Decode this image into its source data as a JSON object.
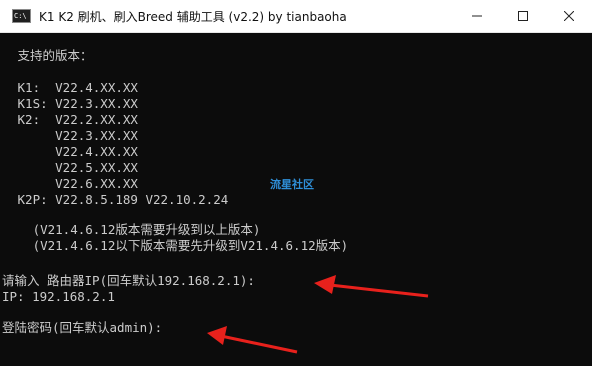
{
  "window": {
    "title": "K1 K2 刷机、刷入Breed 辅助工具 (v2.2)   by tianbaoha",
    "icon_label": "C:\\",
    "controls": [
      "minimize-icon",
      "maximize-icon",
      "close-icon"
    ]
  },
  "console": {
    "lines": [
      " 支持的版本：",
      "",
      " K1:  V22.4.XX.XX",
      " K1S: V22.3.XX.XX",
      " K2:  V22.2.XX.XX",
      "      V22.3.XX.XX",
      "      V22.4.XX.XX",
      "      V22.5.XX.XX",
      "      V22.6.XX.XX",
      " K2P: V22.8.5.189 V22.10.2.24",
      "",
      "   (V21.4.6.12版本需要升级到以上版本)",
      "   (V21.4.6.12以下版本需要先升级到V21.4.6.12版本)",
      "",
      "请输入 路由器IP(回车默认192.168.2.1):",
      "IP: 192.168.2.1",
      "",
      "登陆密码(回车默认admin):"
    ]
  },
  "watermark": "流星社区",
  "annotation_color": "#e8211c"
}
